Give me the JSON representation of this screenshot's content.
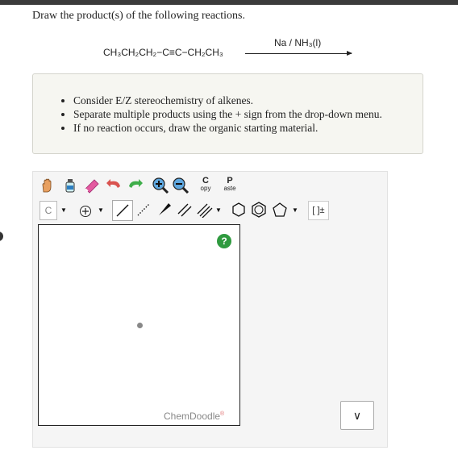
{
  "question": {
    "prompt": "Draw the product(s) of the following reactions.",
    "reactant": "CH₃CH₂CH₂−C≡C−CH₂CH₃",
    "reagent": "Na / NH₃(l)"
  },
  "hints": [
    "Consider E/Z stereochemistry of alkenes.",
    "Separate multiple products using the + sign from the drop-down menu.",
    "If no reaction occurs, draw the organic starting material."
  ],
  "toolbar": {
    "copy_label": "C",
    "copy_sub": "opy",
    "paste_label": "P",
    "paste_sub": "aste",
    "element_label": "C",
    "bracket_label": "[ ]±"
  },
  "canvas": {
    "help_label": "?",
    "brand": "ChemDoodle",
    "brand_mark": "®"
  },
  "select": {
    "chevron": "∨"
  },
  "colors": {
    "hint_bg": "#f6f6f1",
    "help_green": "#2f9a3f",
    "eraser_pink": "#e35aa0",
    "undo_red": "#d9534f",
    "redo_green": "#3fae4a"
  }
}
